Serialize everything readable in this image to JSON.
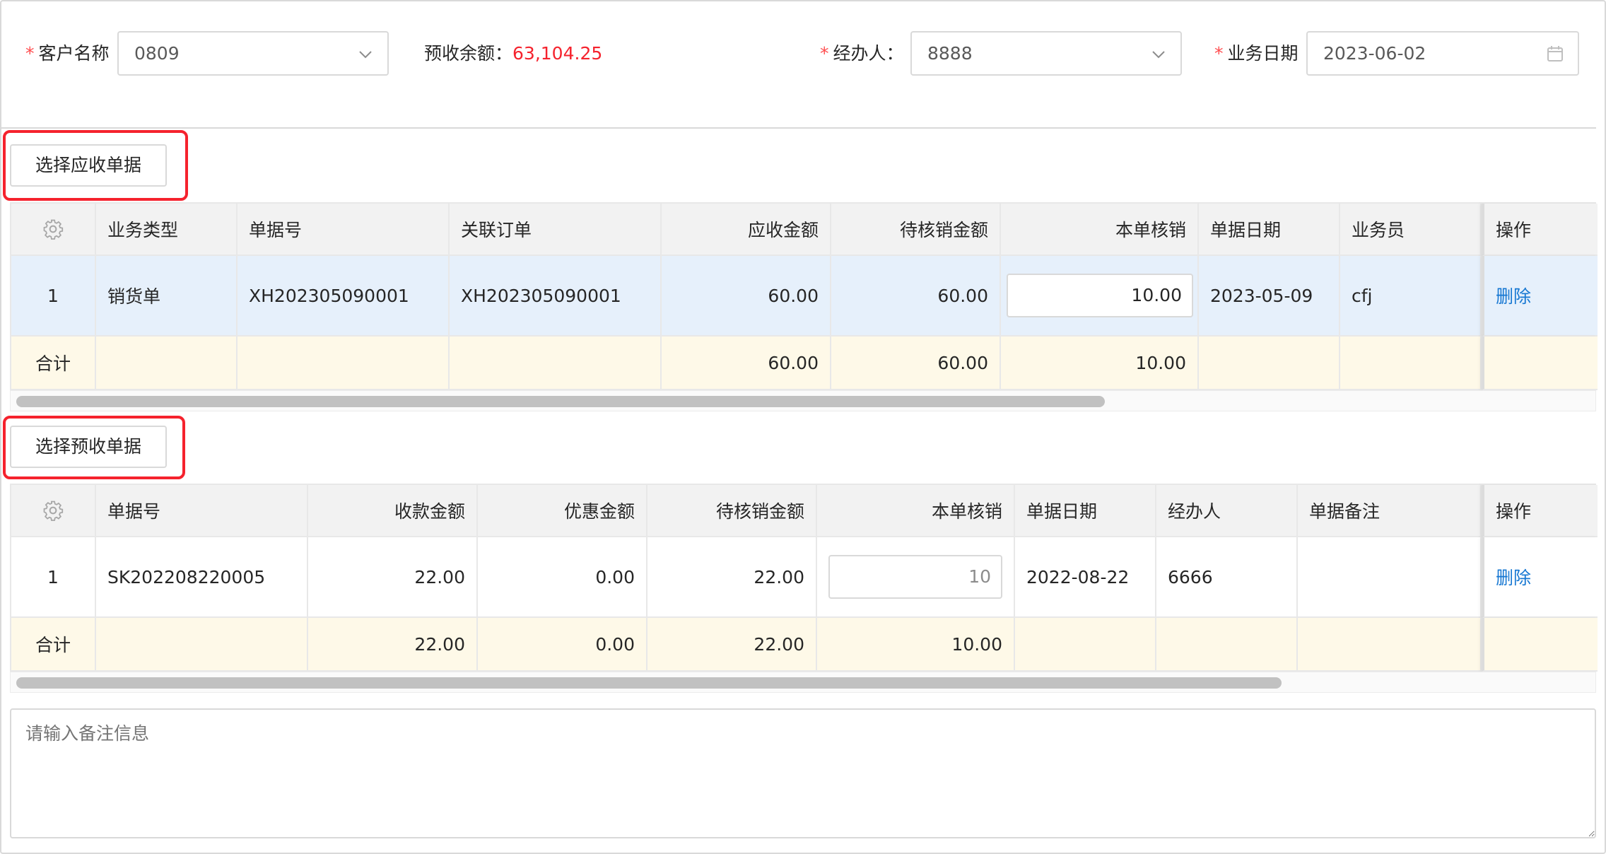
{
  "form": {
    "customer": {
      "label": "客户名称",
      "value": "0809"
    },
    "balance": {
      "label": "预收余额：",
      "value": "63,104.25"
    },
    "handler": {
      "label": "经办人：",
      "value": "8888"
    },
    "date": {
      "label": "业务日期",
      "value": "2023-06-02"
    },
    "required_mark": "*"
  },
  "receivable": {
    "button_label": "选择应收单据",
    "headers": [
      "业务类型",
      "单据号",
      "关联订单",
      "应收金额",
      "待核销金额",
      "本单核销",
      "单据日期",
      "业务员",
      "操作"
    ],
    "rows": [
      {
        "index": "1",
        "type": "销货单",
        "doc_no": "XH202305090001",
        "order_no": "XH202305090001",
        "receivable": "60.00",
        "pending": "60.00",
        "writeoff": "10.00",
        "date": "2023-05-09",
        "salesman": "cfj",
        "action": "删除"
      }
    ],
    "total": {
      "label": "合计",
      "receivable": "60.00",
      "pending": "60.00",
      "writeoff": "10.00"
    }
  },
  "advance": {
    "button_label": "选择预收单据",
    "headers": [
      "单据号",
      "收款金额",
      "优惠金额",
      "待核销金额",
      "本单核销",
      "单据日期",
      "经办人",
      "单据备注",
      "操作"
    ],
    "rows": [
      {
        "index": "1",
        "doc_no": "SK202208220005",
        "received": "22.00",
        "discount": "0.00",
        "pending": "22.00",
        "writeoff": "10",
        "date": "2022-08-22",
        "handler": "6666",
        "remark": "",
        "action": "删除"
      }
    ],
    "total": {
      "label": "合计",
      "received": "22.00",
      "discount": "0.00",
      "pending": "22.00",
      "writeoff": "10.00"
    }
  },
  "remark": {
    "placeholder": "请输入备注信息"
  },
  "colors": {
    "accent": "#1677d2",
    "danger": "#f5222d",
    "row_selected": "#e6f0fb",
    "summary_row": "#fef9e8"
  },
  "icons": {
    "settings": "gear-icon",
    "dropdown": "chevron-down-icon",
    "calendar": "calendar-icon"
  }
}
